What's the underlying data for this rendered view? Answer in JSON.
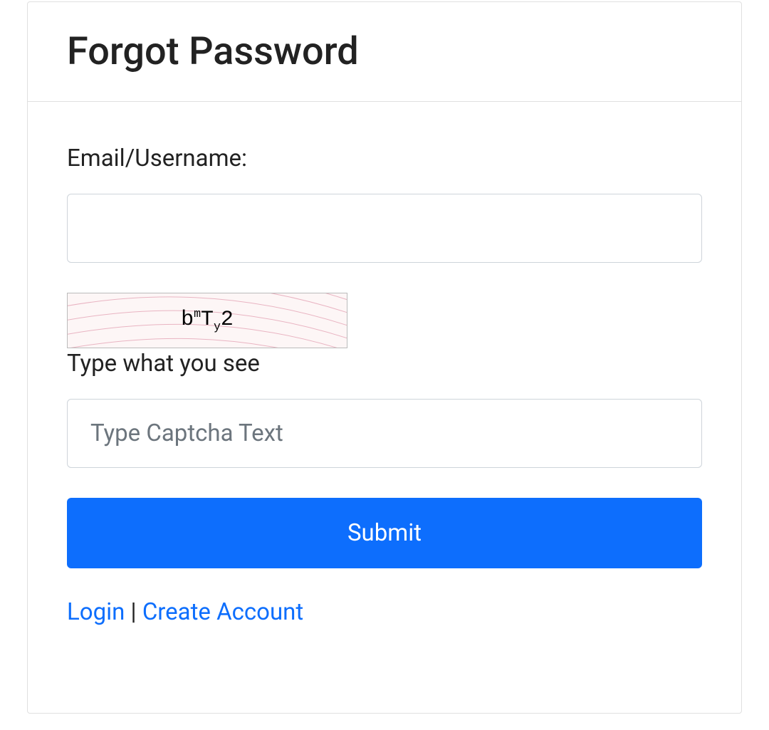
{
  "header": {
    "title": "Forgot Password"
  },
  "form": {
    "email_label": "Email/Username:",
    "email_value": "",
    "captcha_hint": "Type what you see",
    "captcha_placeholder": "Type Captcha Text",
    "captcha_value": "",
    "captcha_display": "bmTy2",
    "submit_label": "Submit"
  },
  "links": {
    "login": "Login",
    "separator": " | ",
    "create_account": "Create Account"
  },
  "colors": {
    "primary": "#0d6efd",
    "border": "#e0e0e0",
    "text": "#222"
  }
}
